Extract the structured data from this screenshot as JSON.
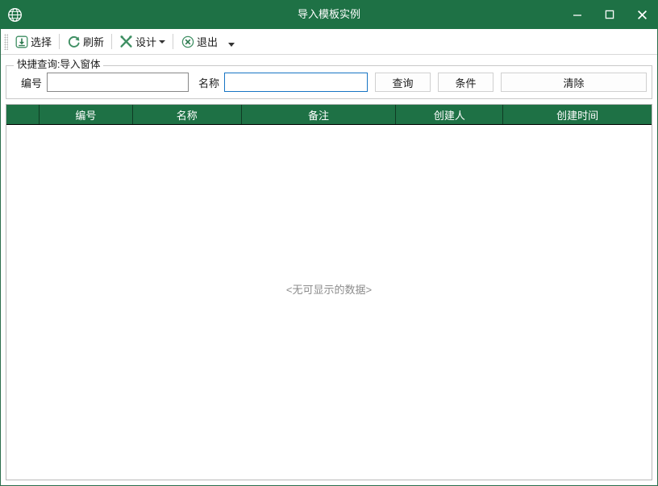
{
  "window": {
    "title": "导入模板实例",
    "icon": "globe-icon",
    "accent_green": "#1e7145",
    "controls": {
      "minimize": "–",
      "maximize": "❐",
      "close": "✕"
    }
  },
  "toolbar": {
    "items": [
      {
        "label": "选择",
        "icon": "download-box-icon",
        "has_caret": false
      },
      {
        "label": "刷新",
        "icon": "refresh-icon",
        "has_caret": false
      },
      {
        "label": "设计",
        "icon": "tools-icon",
        "has_caret": true
      },
      {
        "label": "退出",
        "icon": "close-circle-icon",
        "has_caret": false
      }
    ],
    "overflow": "toolbar-overflow-chevron"
  },
  "query_panel": {
    "legend": "快捷查询:导入窗体",
    "fields": [
      {
        "label": "编号",
        "value": "",
        "placeholder": "",
        "focused": false
      },
      {
        "label": "名称",
        "value": "",
        "placeholder": "",
        "focused": true
      }
    ],
    "buttons": [
      {
        "label": "查询",
        "size": "small"
      },
      {
        "label": "条件",
        "size": "small"
      },
      {
        "label": "清除",
        "size": "wide"
      }
    ]
  },
  "grid": {
    "columns": [
      {
        "title": "",
        "width": 41
      },
      {
        "title": "编号",
        "width": 116
      },
      {
        "title": "名称",
        "width": 135
      },
      {
        "title": "备注",
        "width": 192
      },
      {
        "title": "创建人",
        "width": 133
      },
      {
        "title": "创建时间",
        "width": 184
      }
    ],
    "rows": [],
    "empty_message": "<无可显示的数据>"
  }
}
